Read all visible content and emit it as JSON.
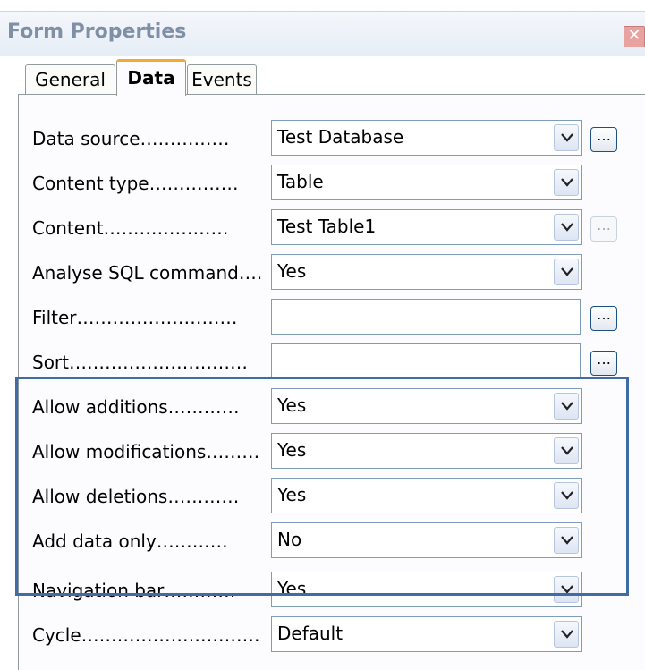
{
  "window": {
    "title": "Form Properties",
    "close_glyph": "✕"
  },
  "tabs": [
    {
      "label": "General"
    },
    {
      "label": "Data",
      "selected": true
    },
    {
      "label": "Events"
    }
  ],
  "rows": [
    {
      "label": "Data source……………",
      "value": "Test Database",
      "button": "…"
    },
    {
      "label": "Content type……………",
      "value": "Table"
    },
    {
      "label": "Content…………………",
      "value": "Test Table1",
      "button": "…"
    },
    {
      "label": "Analyse SQL command….",
      "value": "Yes"
    },
    {
      "label": "Filter………………………",
      "value": "",
      "button": "…"
    },
    {
      "label": "Sort…………………………",
      "value": "",
      "button": "…"
    },
    {
      "label": "Allow additions…………",
      "value": "Yes"
    },
    {
      "label": "Allow modifications………",
      "value": "Yes"
    },
    {
      "label": "Allow deletions…………",
      "value": "Yes"
    },
    {
      "label": "Add data only…………",
      "value": "No"
    },
    {
      "label": "Navigation bar…………",
      "value": "Yes"
    },
    {
      "label": "Cycle…………………………",
      "value": "Default"
    }
  ],
  "colors": {
    "highlight_border": "#3f6ba6",
    "active_tab_accent": "#f3a934"
  }
}
